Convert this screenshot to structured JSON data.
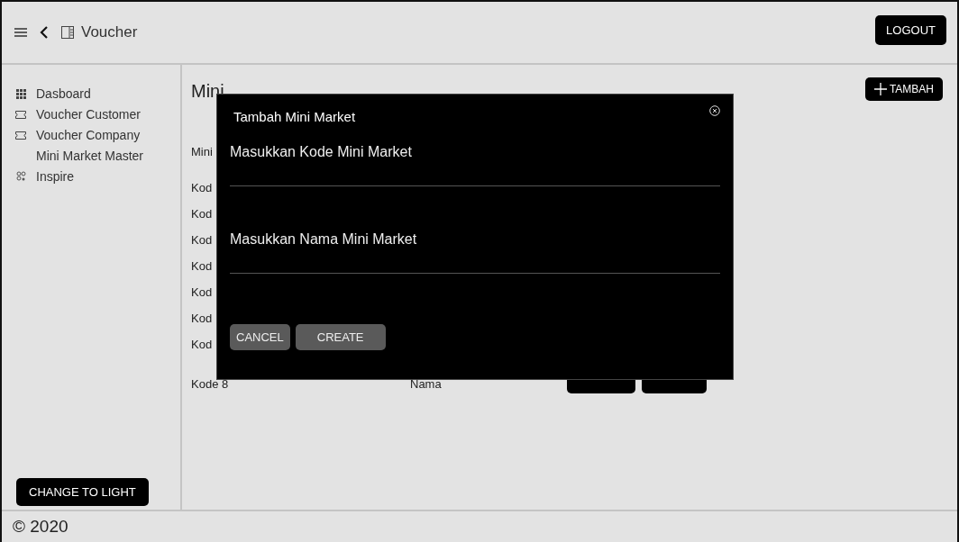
{
  "header": {
    "title": "Voucher",
    "logout": "LOGOUT"
  },
  "sidebar": {
    "items": [
      {
        "label": "Dasboard",
        "kind": "grid"
      },
      {
        "label": "Voucher Customer",
        "kind": "ticket"
      },
      {
        "label": "Voucher Company",
        "kind": "ticket"
      },
      {
        "label": "Mini Market Master",
        "kind": "plain"
      },
      {
        "label": "Inspire",
        "kind": "cluster"
      }
    ],
    "theme_button": "CHANGE TO LIGHT"
  },
  "page": {
    "title": "Mini",
    "add_button": "TAMBAH",
    "list_label": "Mini",
    "rows": [
      "Kod",
      "Kod",
      "Kod",
      "Kod",
      "Kod",
      "Kod",
      "Kod"
    ],
    "last_row": {
      "kode": "Kode 8",
      "nama": "Nama"
    }
  },
  "dialog": {
    "title": "Tambah Mini Market",
    "fields": [
      {
        "placeholder": "Masukkan Kode Mini Market"
      },
      {
        "placeholder": "Masukkan Nama Mini Market"
      }
    ],
    "buttons": [
      "CANCEL",
      "CREATE"
    ]
  },
  "footer": "© 2020"
}
